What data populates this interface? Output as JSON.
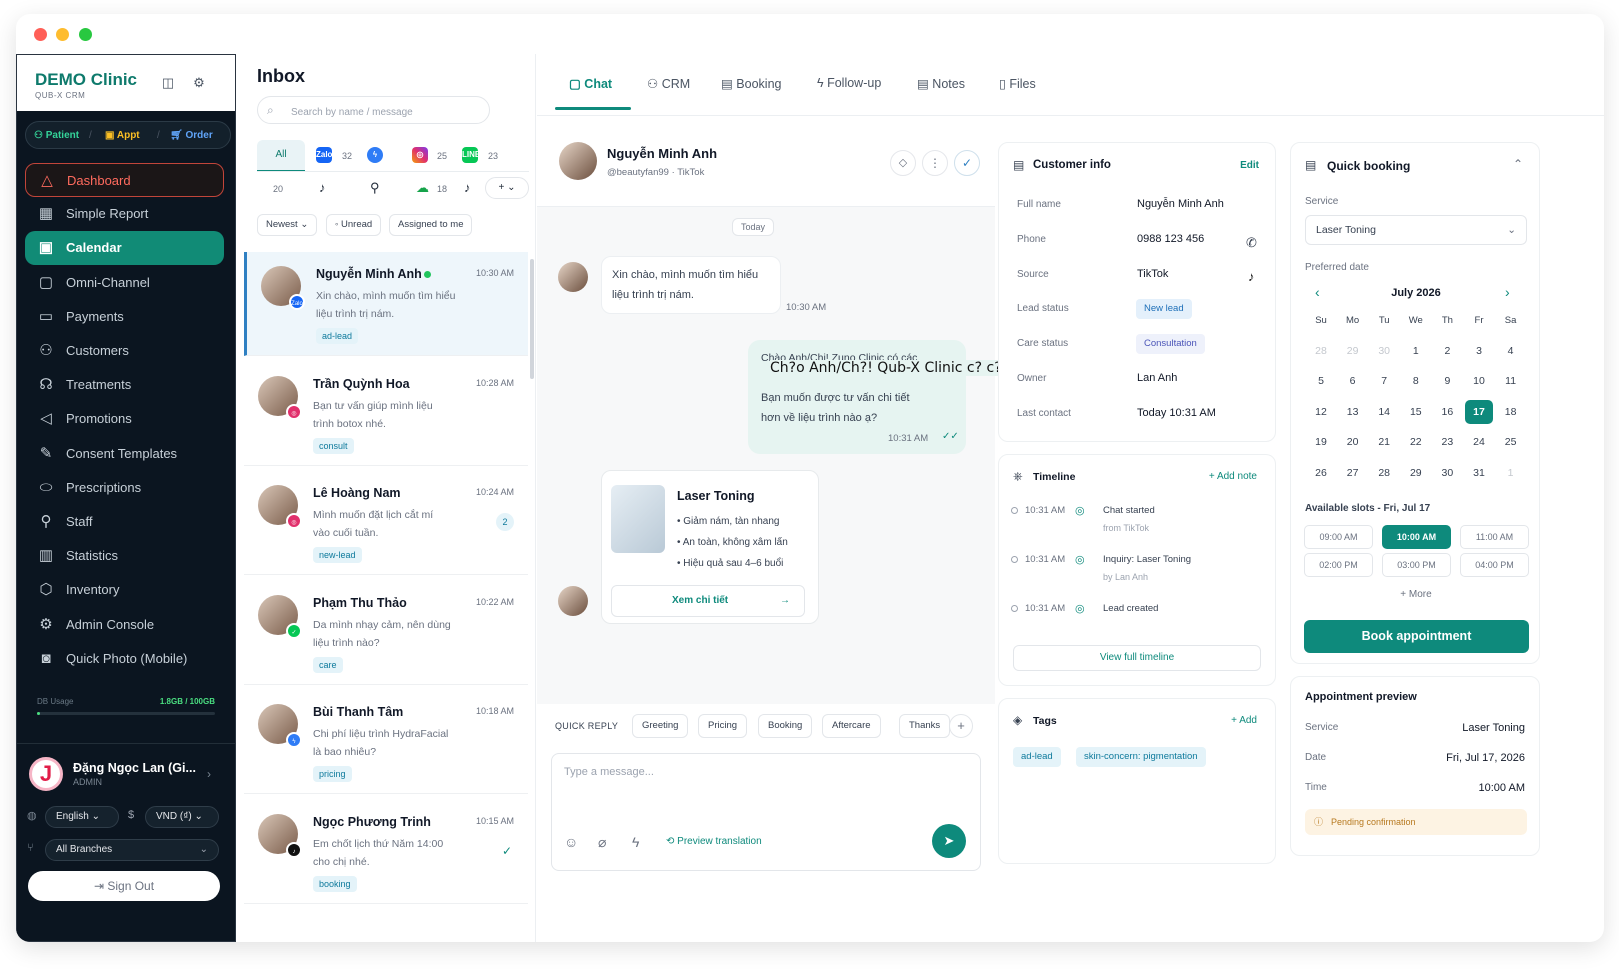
{
  "sidebar": {
    "brand": "DEMO Clinic",
    "brand_sub": "QUB-X CRM",
    "quick": {
      "patient": "Patient",
      "appt": "Appt",
      "order": "Order"
    },
    "items": [
      {
        "label": "Dashboard",
        "icon": "warning-triangle-icon"
      },
      {
        "label": "Simple Report",
        "icon": "grid-icon"
      },
      {
        "label": "Calendar",
        "icon": "calendar-icon"
      },
      {
        "label": "Omni-Channel",
        "icon": "chat-icon"
      },
      {
        "label": "Payments",
        "icon": "card-icon"
      },
      {
        "label": "Customers",
        "icon": "users-icon"
      },
      {
        "label": "Treatments",
        "icon": "stethoscope-icon"
      },
      {
        "label": "Promotions",
        "icon": "megaphone-icon"
      },
      {
        "label": "Consent Templates",
        "icon": "document-edit-icon"
      },
      {
        "label": "Prescriptions",
        "icon": "pill-icon"
      },
      {
        "label": "Staff",
        "icon": "user-gear-icon"
      },
      {
        "label": "Statistics",
        "icon": "bar-chart-icon"
      },
      {
        "label": "Inventory",
        "icon": "box-icon"
      },
      {
        "label": "Admin Console",
        "icon": "gear-icon"
      },
      {
        "label": "Quick Photo (Mobile)",
        "icon": "camera-icon"
      }
    ],
    "usage_label": "DB Usage",
    "usage_value": "1.8GB / 100GB",
    "usage_fraction": 0.018,
    "user_initial": "J",
    "user_name": "Đặng Ngọc Lan (Gi...",
    "user_role": "ADMIN",
    "language": "English",
    "currency_symbol": "$",
    "currency": "VND (₫)",
    "branch": "All Branches",
    "signout": "Sign Out"
  },
  "inbox": {
    "title": "Inbox",
    "search_placeholder": "Search by name / message",
    "channels": {
      "all": "All",
      "zalo": "32",
      "instagram": "25",
      "line": "23",
      "row2_count": "20",
      "wechat_count": "18"
    },
    "filters": {
      "newest": "Newest",
      "unread": "Unread",
      "assigned": "Assigned to me"
    },
    "conversations": [
      {
        "name": "Nguyễn Minh Anh",
        "time": "10:30 AM",
        "msg": "Xin chào, mình muốn tìm hiểu liệu trình trị nám.",
        "tag": "ad-lead"
      },
      {
        "name": "Trần Quỳnh Hoa",
        "time": "10:28 AM",
        "msg": "Bạn tư vấn giúp mình liệu trình botox nhé.",
        "tag": "consult"
      },
      {
        "name": "Lê Hoàng Nam",
        "time": "10:24 AM",
        "msg": "Mình muốn đặt lịch cắt mí vào cuối tuần.",
        "tag": "new-lead",
        "unread": "2"
      },
      {
        "name": "Phạm Thu Thảo",
        "time": "10:22 AM",
        "msg": "Da mình nhạy cảm, nên dùng liệu trình nào?",
        "tag": "care"
      },
      {
        "name": "Bùi Thanh Tâm",
        "time": "10:18 AM",
        "msg": "Chi phí liệu trình HydraFacial là bao nhiêu?",
        "tag": "pricing"
      },
      {
        "name": "Ngọc Phương Trinh",
        "time": "10:15 AM",
        "msg": "Em chốt lịch thứ Năm 14:00 cho chị nhé.",
        "tag": "booking"
      }
    ]
  },
  "tabs": [
    "Chat",
    "CRM",
    "Booking",
    "Follow-up",
    "Notes",
    "Files"
  ],
  "chat": {
    "name": "Nguyễn Minh Anh",
    "handle": "@beautyfan99",
    "source": "TikTok",
    "day": "Today",
    "msg1": "Xin chào, mình muốn tìm hiểu liệu trình trị nám.",
    "msg1_time": "10:30 AM",
    "msg2_line1": "Chào Anh/Chị! Zuno Clinic có các",
    "msg2_overlay": "Ch?o Anh/Ch?! Qub-X Clinic c? c?c",
    "msg2_line3": "Bạn muốn được tư vấn chi tiết",
    "msg2_line4": "hơn về liệu trình nào ạ?",
    "msg2_time": "10:31 AM",
    "card_title": "Laser Toning",
    "card_points": [
      "Giảm nám, tàn nhang",
      "An toàn, không xâm lấn",
      "Hiệu quả sau 4–6 buổi"
    ],
    "card_link": "Xem chi tiết",
    "quick_reply": "QUICK REPLY",
    "quick_chips": [
      "Greeting",
      "Pricing",
      "Booking",
      "Aftercare",
      "Thanks"
    ],
    "input_placeholder": "Type a message...",
    "preview": "Preview translation"
  },
  "customer": {
    "title": "Customer info",
    "edit": "Edit",
    "rows": [
      [
        "Full name",
        "Nguyễn Minh Anh"
      ],
      [
        "Phone",
        "0988 123 456"
      ],
      [
        "Source",
        "TikTok"
      ],
      [
        "Lead status",
        "New lead"
      ],
      [
        "Care status",
        "Consultation"
      ],
      [
        "Owner",
        "Lan Anh"
      ],
      [
        "Last contact",
        "Today 10:31 AM"
      ]
    ]
  },
  "timeline": {
    "title": "Timeline",
    "add": "Add note",
    "events": [
      {
        "time": "10:31 AM",
        "title": "Chat started",
        "sub": "from TikTok"
      },
      {
        "time": "10:31 AM",
        "title": "Inquiry: Laser Toning",
        "sub": "by Lan Anh"
      },
      {
        "time": "10:31 AM",
        "title": "Lead created",
        "sub": ""
      }
    ],
    "view_all": "View full timeline"
  },
  "tags": {
    "title": "Tags",
    "add": "Add",
    "items": [
      "ad-lead",
      "skin-concern: pigmentation"
    ]
  },
  "booking": {
    "title": "Quick booking",
    "service_label": "Service",
    "service": "Laser Toning",
    "date_label": "Preferred date",
    "month": "July 2026",
    "weekdays": [
      "Su",
      "Mo",
      "Tu",
      "We",
      "Th",
      "Fr",
      "Sa"
    ],
    "days": [
      "28",
      "29",
      "30",
      "1",
      "2",
      "3",
      "4",
      "5",
      "6",
      "7",
      "8",
      "9",
      "10",
      "11",
      "12",
      "13",
      "14",
      "15",
      "16",
      "17",
      "18",
      "19",
      "20",
      "21",
      "22",
      "23",
      "24",
      "25",
      "26",
      "27",
      "28",
      "29",
      "30",
      "31",
      "1"
    ],
    "selected": "17",
    "slots_label": "Available slots - Fri, Jul 17",
    "slots": [
      "09:00 AM",
      "10:00 AM",
      "11:00 AM",
      "02:00 PM",
      "03:00 PM",
      "04:00 PM"
    ],
    "selected_slot": "10:00 AM",
    "more": "+ More",
    "book": "Book appointment"
  },
  "preview": {
    "title": "Appointment preview",
    "service_label": "Service",
    "service": "Laser Toning",
    "date_label": "Date",
    "date": "Fri, Jul 17, 2026",
    "time_label": "Time",
    "time": "10:00 AM",
    "status": "Pending confirmation"
  },
  "colors": {
    "brand": "#0e8a7c",
    "sidebar": "#0b1520",
    "danger": "#ff6b5e"
  }
}
